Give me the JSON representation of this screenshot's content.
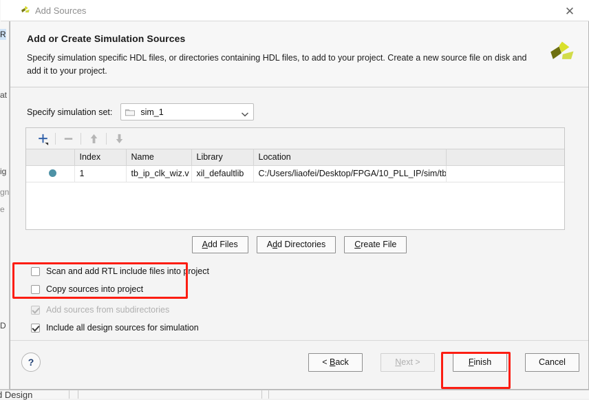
{
  "background": {
    "fragments": [
      {
        "text": "R",
        "selected": true
      },
      {
        "text": "at"
      },
      {
        "text": "ig"
      },
      {
        "text": "gn"
      },
      {
        "text": "e"
      },
      {
        "text": "D"
      },
      {
        "text": "d Design"
      }
    ]
  },
  "titlebar": {
    "title": "Add Sources",
    "icon": "vivado-logo-icon",
    "close_label": "✕"
  },
  "header": {
    "title": "Add or Create Simulation Sources",
    "description": "Specify simulation specific HDL files, or directories containing HDL files, to add to your project. Create a new source file on disk and add it to your project.",
    "logo": "xilinx-logo-icon"
  },
  "simulation_set": {
    "label": "Specify simulation set:",
    "value": "sim_1",
    "folder_icon": "folder-icon",
    "chevron_icon": "chevron-down-icon"
  },
  "file_list": {
    "toolbar": [
      {
        "name": "add-button",
        "icon": "plus-icon",
        "enabled": true
      },
      {
        "name": "remove-button",
        "icon": "minus-icon",
        "enabled": false
      },
      {
        "name": "move-up-button",
        "icon": "arrow-up-icon",
        "enabled": false
      },
      {
        "name": "move-down-button",
        "icon": "arrow-down-icon",
        "enabled": false
      }
    ],
    "columns": [
      "",
      "Index",
      "Name",
      "Library",
      "Location",
      ""
    ],
    "rows": [
      {
        "status_dot": true,
        "index": "1",
        "name": "tb_ip_clk_wiz.v",
        "library": "xil_defaultlib",
        "location": "C:/Users/liaofei/Desktop/FPGA/10_PLL_IP/sim/tb"
      }
    ]
  },
  "action_buttons": [
    {
      "label": "Add Files",
      "mnemonic": "A",
      "enabled": true
    },
    {
      "label": "Add Directories",
      "mnemonic": "d",
      "enabled": true
    },
    {
      "label": "Create File",
      "mnemonic": "C",
      "enabled": true
    }
  ],
  "checkboxes": [
    {
      "label": "Scan and add RTL include files into project",
      "checked": false,
      "enabled": true,
      "highlighted": true
    },
    {
      "label": "Copy sources into project",
      "checked": false,
      "enabled": true,
      "highlighted": true
    },
    {
      "label": "Add sources from subdirectories",
      "checked": true,
      "enabled": false,
      "highlighted": false
    },
    {
      "label": "Include all design sources for simulation",
      "checked": true,
      "enabled": true,
      "highlighted": false
    }
  ],
  "footer": {
    "help_label": "?",
    "buttons": [
      {
        "label": "< Back",
        "enabled": true,
        "highlighted": false
      },
      {
        "label": "Next >",
        "enabled": false,
        "highlighted": false
      },
      {
        "label": "Finish",
        "enabled": true,
        "highlighted": true
      },
      {
        "label": "Cancel",
        "enabled": true,
        "highlighted": false
      }
    ]
  },
  "annotation": {
    "color": "#fc1d12",
    "boxes": [
      "checkbox-group-highlight",
      "finish-button-highlight"
    ]
  }
}
